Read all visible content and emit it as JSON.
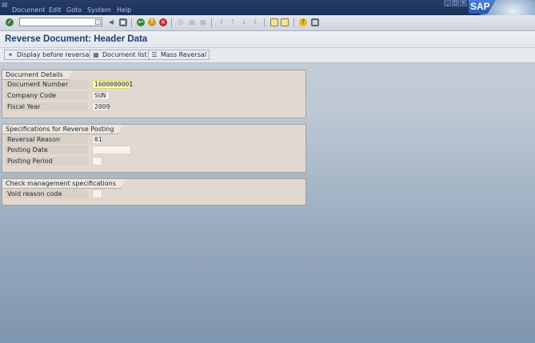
{
  "menubar": {
    "items": [
      "Document",
      "Edit",
      "Goto",
      "System",
      "Help"
    ],
    "logo": "SAP"
  },
  "toolbar": {
    "command_field_value": "",
    "icons": [
      "enter-icon",
      "save-icon",
      "back-icon",
      "exit-icon",
      "cancel-icon",
      "print-icon",
      "find-icon",
      "find-next-icon",
      "first-page-icon",
      "previous-page-icon",
      "next-page-icon",
      "last-page-icon",
      "create-session-icon",
      "shortcut-icon",
      "help-icon",
      "customize-layout-icon"
    ]
  },
  "title": "Reverse Document: Header Data",
  "app_toolbar": {
    "buttons": [
      "Display before reversal",
      "Document list",
      "Mass Reversal"
    ]
  },
  "groups": {
    "document_details": {
      "title": "Document Details",
      "fields": [
        {
          "label": "Document Number",
          "value": "1600000001"
        },
        {
          "label": "Company Code",
          "value": "SUN"
        },
        {
          "label": "Fiscal Year",
          "value": "2009"
        }
      ]
    },
    "specifications": {
      "title": "Specifications for Reverse Posting",
      "fields": [
        {
          "label": "Reversal Reason",
          "value": "01"
        },
        {
          "label": "Posting Date",
          "value": ""
        },
        {
          "label": "Posting Period",
          "value": ""
        }
      ]
    },
    "check_management": {
      "title": "Check management specifications",
      "fields": [
        {
          "label": "Void reason code",
          "value": ""
        }
      ]
    }
  },
  "colors": {
    "menubar": "#1c2f58",
    "title_text": "#1f3c74",
    "group_bg": "#e1d9d0",
    "required_field": "#fffbb8"
  }
}
